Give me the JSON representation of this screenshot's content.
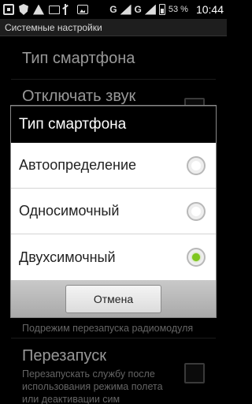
{
  "status_bar": {
    "network": "G",
    "network2": "G",
    "battery": "53 %",
    "time": "10:44",
    "icons": [
      "grid-icon",
      "shield-icon",
      "warning-icon",
      "mail-icon",
      "usb-icon",
      "image-icon",
      "signal-icon",
      "battery-icon"
    ]
  },
  "title_bar": {
    "title": "Системные настройки"
  },
  "background": {
    "item1": "Тип смартфона",
    "item2": "Отключать звук",
    "item3_summary": "Подрежим перезапуска радиомодуля",
    "item4": "Перезапуск",
    "item4_summary": "Перезапускать службу после использования режима полета или деактивации сим"
  },
  "dialog": {
    "title": "Тип смартфона",
    "options": [
      {
        "label": "Автоопределение",
        "checked": false
      },
      {
        "label": "Односимочный",
        "checked": false
      },
      {
        "label": "Двухсимочный",
        "checked": true
      }
    ],
    "cancel_label": "Отмена"
  },
  "colors": {
    "accent_radio": "#7ec61e",
    "dialog_bg": "#ffffff",
    "title_bg": "#000000"
  }
}
